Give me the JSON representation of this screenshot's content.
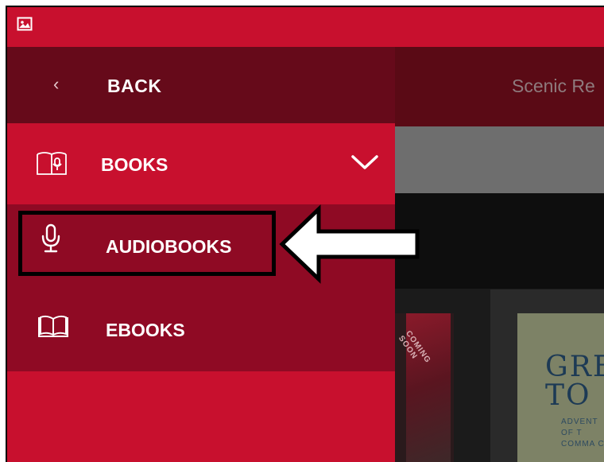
{
  "status_bar": {
    "icon": "image-icon"
  },
  "drawer": {
    "back": {
      "icon": "chevron-left-icon",
      "label": "BACK"
    },
    "books": {
      "icon": "open-book-audio-icon",
      "label": "BOOKS",
      "expand_icon": "chevron-down-icon"
    },
    "sub_items": [
      {
        "icon": "microphone-icon",
        "label": "AUDIOBOOKS"
      },
      {
        "icon": "open-book-icon",
        "label": "EBOOKS"
      }
    ]
  },
  "content": {
    "title": "Scenic Re",
    "card1_text": "COMING SOON",
    "card2_title": "GRE\nTO",
    "card2_sub": "ADVENT\nOF T\nCOMMA C"
  },
  "annotation": {
    "arrow_icon": "left-arrow-icon"
  },
  "colors": {
    "brand_red": "#c8102e",
    "dark_red": "#660a1a",
    "sub_red": "#8f0a24"
  }
}
